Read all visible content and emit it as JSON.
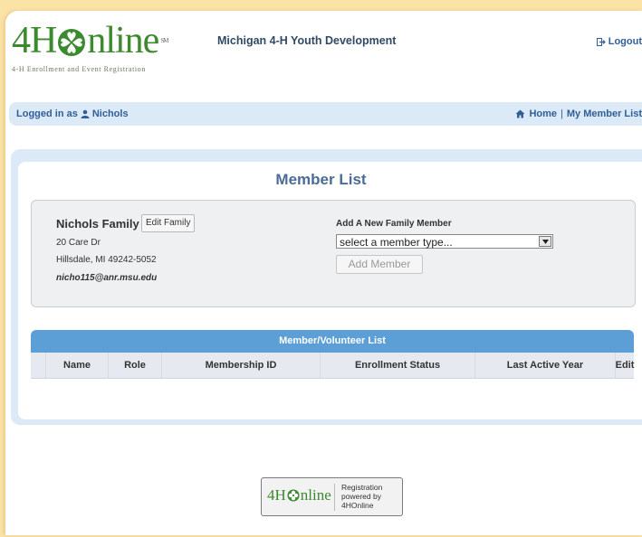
{
  "header": {
    "logo_text_a": "4H",
    "logo_text_b": "nline",
    "logo_tm": "SM",
    "logo_subtitle": "4-H Enrollment and Event Registration",
    "org_title": "Michigan 4-H Youth Development",
    "logout_label": "Logout"
  },
  "userbar": {
    "logged_in_prefix": "Logged in as",
    "user_name": "Nichols",
    "home_label": "Home",
    "separator": "|",
    "member_list_label": "My Member List"
  },
  "panel": {
    "title": "Member List"
  },
  "family": {
    "name": "Nichols Family",
    "edit_label": "Edit Family",
    "address_line1": "20 Care Dr",
    "address_line2": "Hillsdale, MI 49242-5052",
    "email": "nicho115@anr.msu.edu"
  },
  "add_member": {
    "label": "Add A New Family Member",
    "select_value": "select a member type...",
    "button_label": "Add Member"
  },
  "member_list": {
    "title": "Member/Volunteer List",
    "columns": [
      "Name",
      "Role",
      "Membership ID",
      "Enrollment Status",
      "Last Active Year",
      "Edit"
    ]
  },
  "footer": {
    "logo_a": "4H",
    "logo_b": "nline",
    "line1": "Registration",
    "line2": "powered by",
    "line3": "4HOnline"
  },
  "colors": {
    "brand_green": "#3c8a2e",
    "link_blue": "#2f5f9a",
    "header_bar_blue": "#5b9fd6",
    "background_gold": "#fbe3a8"
  },
  "icons": {
    "logout": "logout-icon",
    "user": "user-icon",
    "home": "home-icon",
    "clover": "clover-icon",
    "dropdown": "chevron-down-icon"
  }
}
